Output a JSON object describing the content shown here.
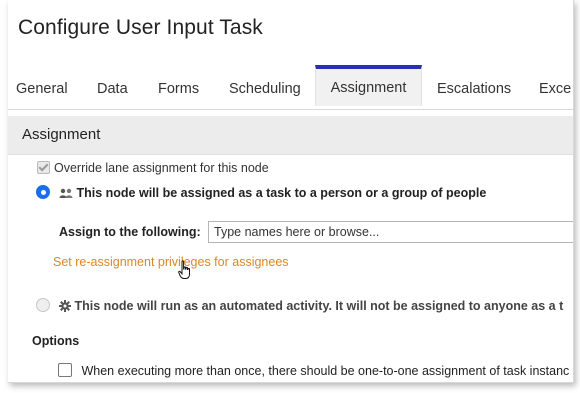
{
  "dialog": {
    "title": "Configure User Input Task"
  },
  "tabs": [
    {
      "label": "General",
      "active": false
    },
    {
      "label": "Data",
      "active": false
    },
    {
      "label": "Forms",
      "active": false
    },
    {
      "label": "Scheduling",
      "active": false
    },
    {
      "label": "Assignment",
      "active": true
    },
    {
      "label": "Escalations",
      "active": false
    },
    {
      "label": "Exce",
      "active": false
    }
  ],
  "assignment": {
    "section_title": "Assignment",
    "override_label": "Override lane assignment for this node",
    "override_checked": true,
    "person_option_label": "This node will be assigned as a task to a person or a group of people",
    "person_option_selected": true,
    "assign_to_label": "Assign to the following:",
    "assign_to_placeholder": "Type names here or browse...",
    "reassign_link": "Set re-assignment privileges for assignees",
    "automated_option_label": "This node will run as an automated activity. It will not be assigned to anyone as a t",
    "automated_option_selected": false
  },
  "options": {
    "title": "Options",
    "one_to_one_label": "When executing more than once, there should be one-to-one assignment of task instanc",
    "one_to_one_checked": false
  },
  "colors": {
    "active_tab_accent": "#2b2fb5",
    "link": "#e0861f",
    "radio_selected": "#1a6ee8"
  },
  "icons": {
    "people": "people-group-icon",
    "gear": "gear-icon",
    "cursor": "hand-pointer-cursor-icon"
  }
}
